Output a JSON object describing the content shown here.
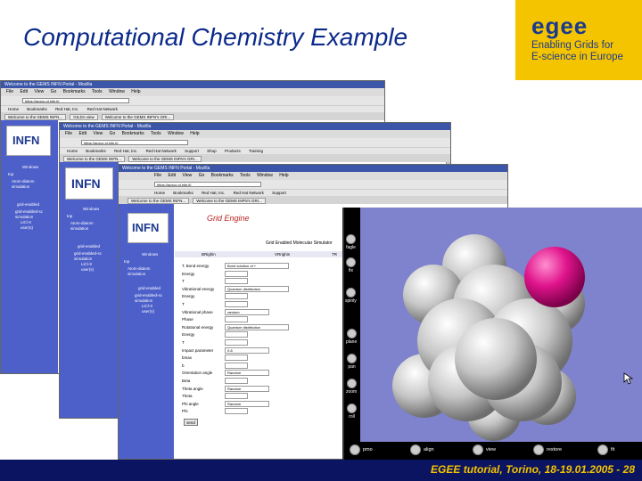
{
  "slide": {
    "title": "Computational Chemistry Example",
    "footer": "EGEE tutorial, Torino, 18-19.01.2005  -  28"
  },
  "logo": {
    "word": "egee",
    "line1": "Enabling Grids for",
    "line2": "E-science in Europe"
  },
  "browser": {
    "title": "Welcome to the GEMS INFN Portal - Mozilla",
    "menu": [
      "File",
      "Edit",
      "View",
      "Go",
      "Bookmarks",
      "Tools",
      "Window",
      "Help"
    ],
    "url": "https://gpxcc.ct.infn.it/",
    "bookmarks": [
      "Home",
      "Bookmarks",
      "Red Hat, Inc.",
      "Red Hat Network",
      "Support",
      "Shop",
      "Products",
      "Training"
    ],
    "tabs": [
      "Welcome to the GEMS INFN...",
      "GILDA view",
      "Welcome to the GEMS INFN's GRI..."
    ]
  },
  "sidebar": {
    "brand": "INFN",
    "section": "Windows",
    "items": [
      "top",
      "Atom-diatom",
      "simulation"
    ],
    "links": [
      "grid-enabled",
      "grid-enabled-sc",
      "simulation",
      "LiCl-X",
      "user(s)"
    ]
  },
  "form": {
    "header_cols": [
      "BRighin",
      "VRrighin",
      "TR"
    ],
    "subtitle": "Grid Enabled Molecular Simulator",
    "portal_logo": "Grid Engine",
    "rows": [
      {
        "label": "T. Bond energy",
        "value": "Bond solution of +"
      },
      {
        "label": "Energy",
        "value": ""
      },
      {
        "label": "T",
        "value": ""
      },
      {
        "label": "Vibrational energy",
        "value": "Quantum distribution"
      },
      {
        "label": "Energy",
        "value": ""
      },
      {
        "label": "T",
        "value": ""
      },
      {
        "label": "Vibrational phase",
        "value": "random"
      },
      {
        "label": "Phase",
        "value": ""
      },
      {
        "label": "Rotational energy",
        "value": "Quantum distribution"
      },
      {
        "label": "Energy",
        "value": ""
      },
      {
        "label": "T",
        "value": ""
      },
      {
        "label": "Impact parameter",
        "value": "0-6"
      },
      {
        "label": "bmax",
        "value": ""
      },
      {
        "label": "b",
        "value": ""
      },
      {
        "label": "Orientation angle",
        "value": "Random"
      },
      {
        "label": "Beta",
        "value": ""
      },
      {
        "label": "Theta angle",
        "value": "Random"
      },
      {
        "label": "Theta",
        "value": ""
      },
      {
        "label": "Phi angle",
        "value": "Random"
      },
      {
        "label": "Phi",
        "value": ""
      }
    ],
    "submit": "send"
  },
  "viewer": {
    "left_buttons": [
      "fagle",
      "fix",
      "zoom",
      "spinly",
      "plane",
      "pan",
      "zoom",
      "roll"
    ],
    "bottom_buttons": [
      "pmo",
      "align",
      "view",
      "restore",
      "fit"
    ],
    "background": "#7f82cc",
    "highlight_atom": "#e0148c"
  }
}
